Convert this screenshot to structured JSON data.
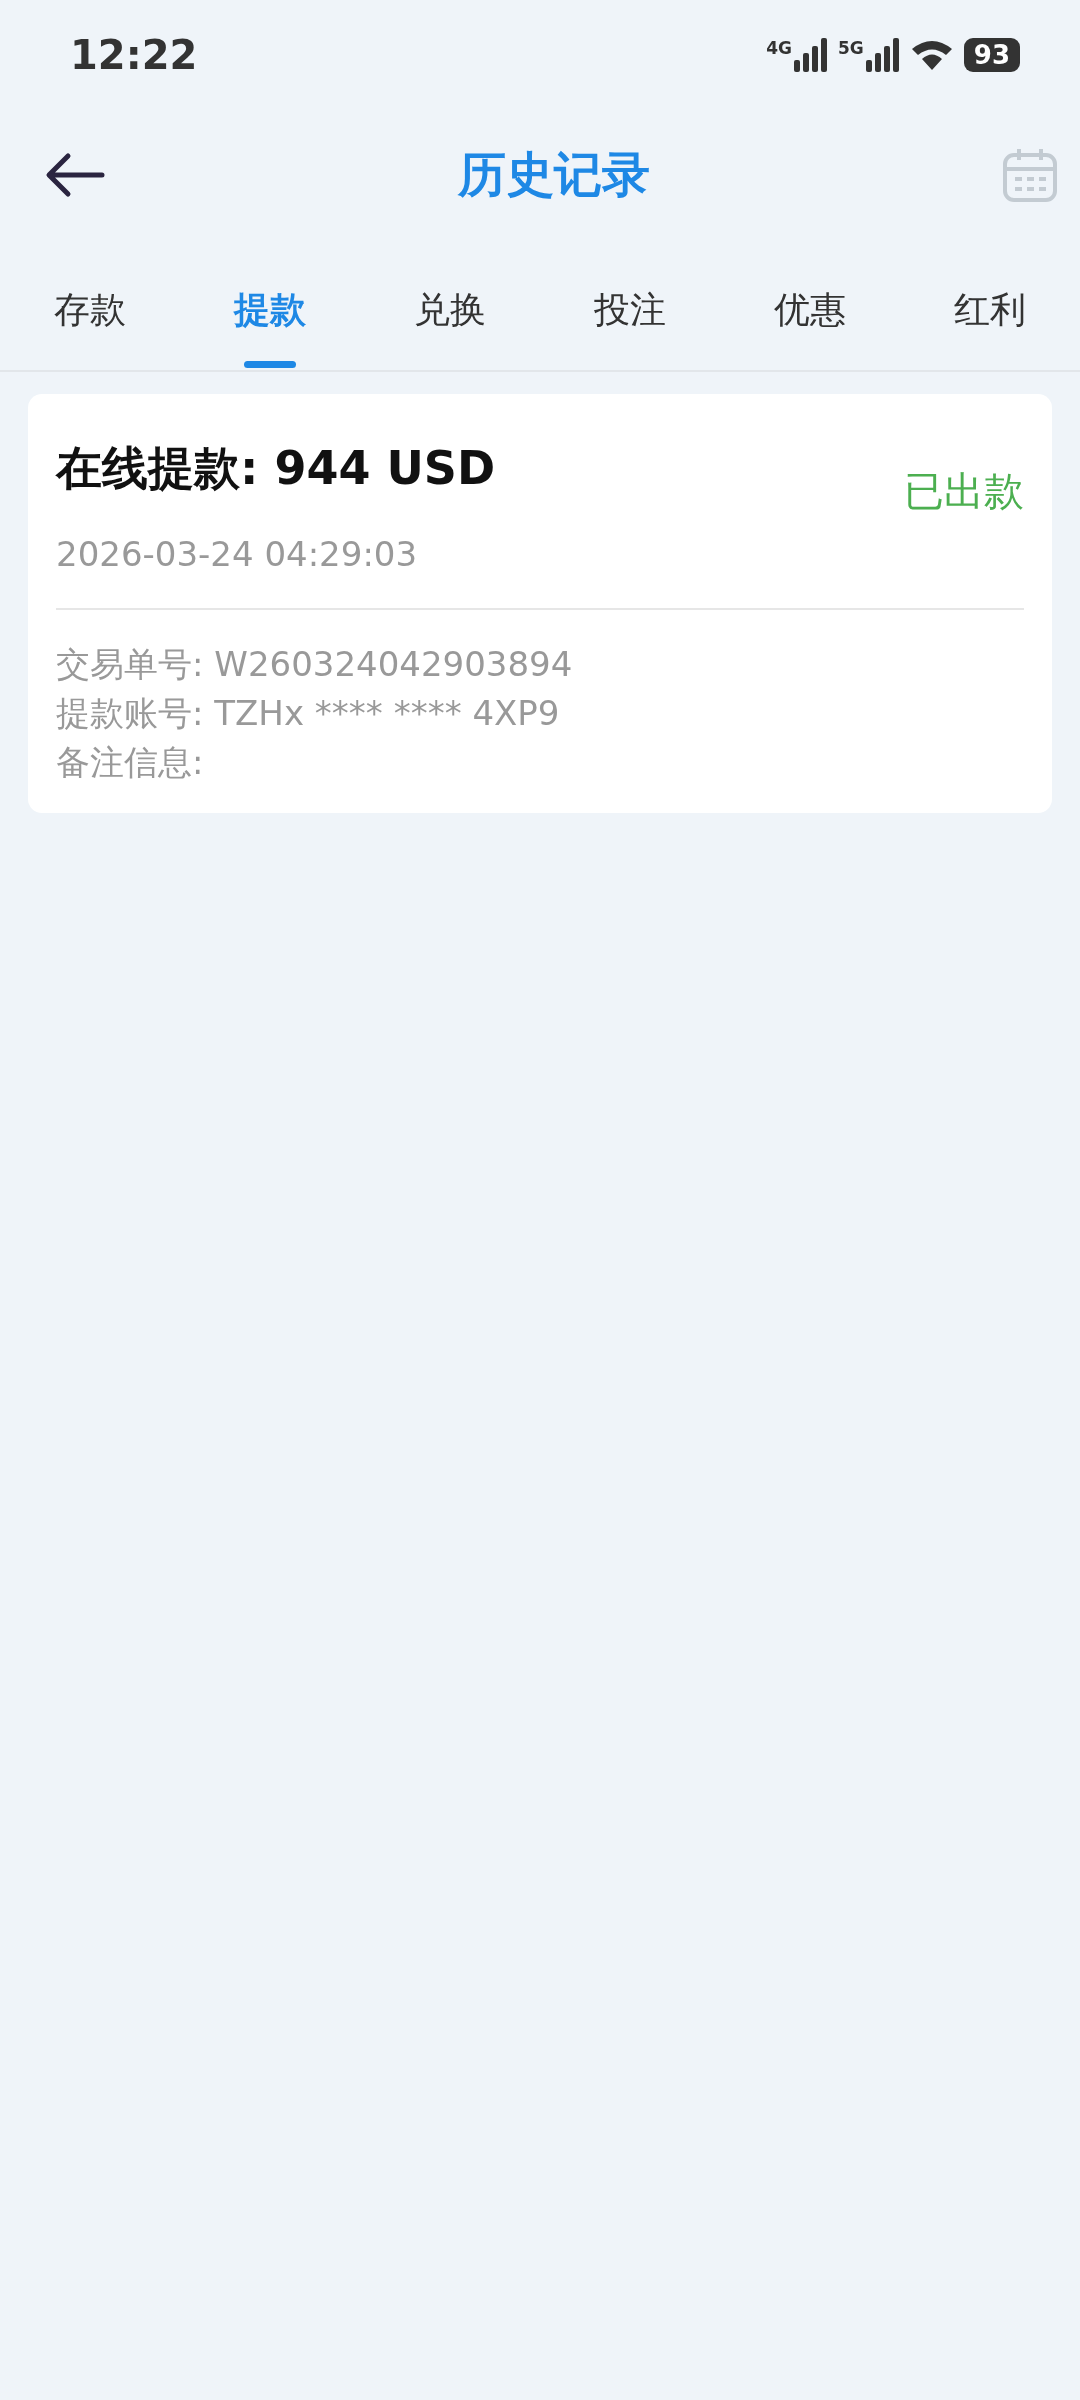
{
  "status_bar": {
    "time": "12:22",
    "network_1": "4G",
    "network_2": "5G",
    "battery": "93"
  },
  "header": {
    "title": "历史记录"
  },
  "tabs": [
    {
      "label": "存款",
      "selected": false
    },
    {
      "label": "提款",
      "selected": true
    },
    {
      "label": "兑换",
      "selected": false
    },
    {
      "label": "投注",
      "selected": false
    },
    {
      "label": "优惠",
      "selected": false
    },
    {
      "label": "红利",
      "selected": false
    }
  ],
  "records": [
    {
      "title": "在线提款: 944 USD",
      "status": "已出款",
      "color": "#4caf50",
      "time": "2026-03-24 04:29:03",
      "details": [
        "交易单号: W260324042903894",
        "提款账号: TZHx **** **** 4XP9",
        "备注信息:"
      ]
    }
  ]
}
